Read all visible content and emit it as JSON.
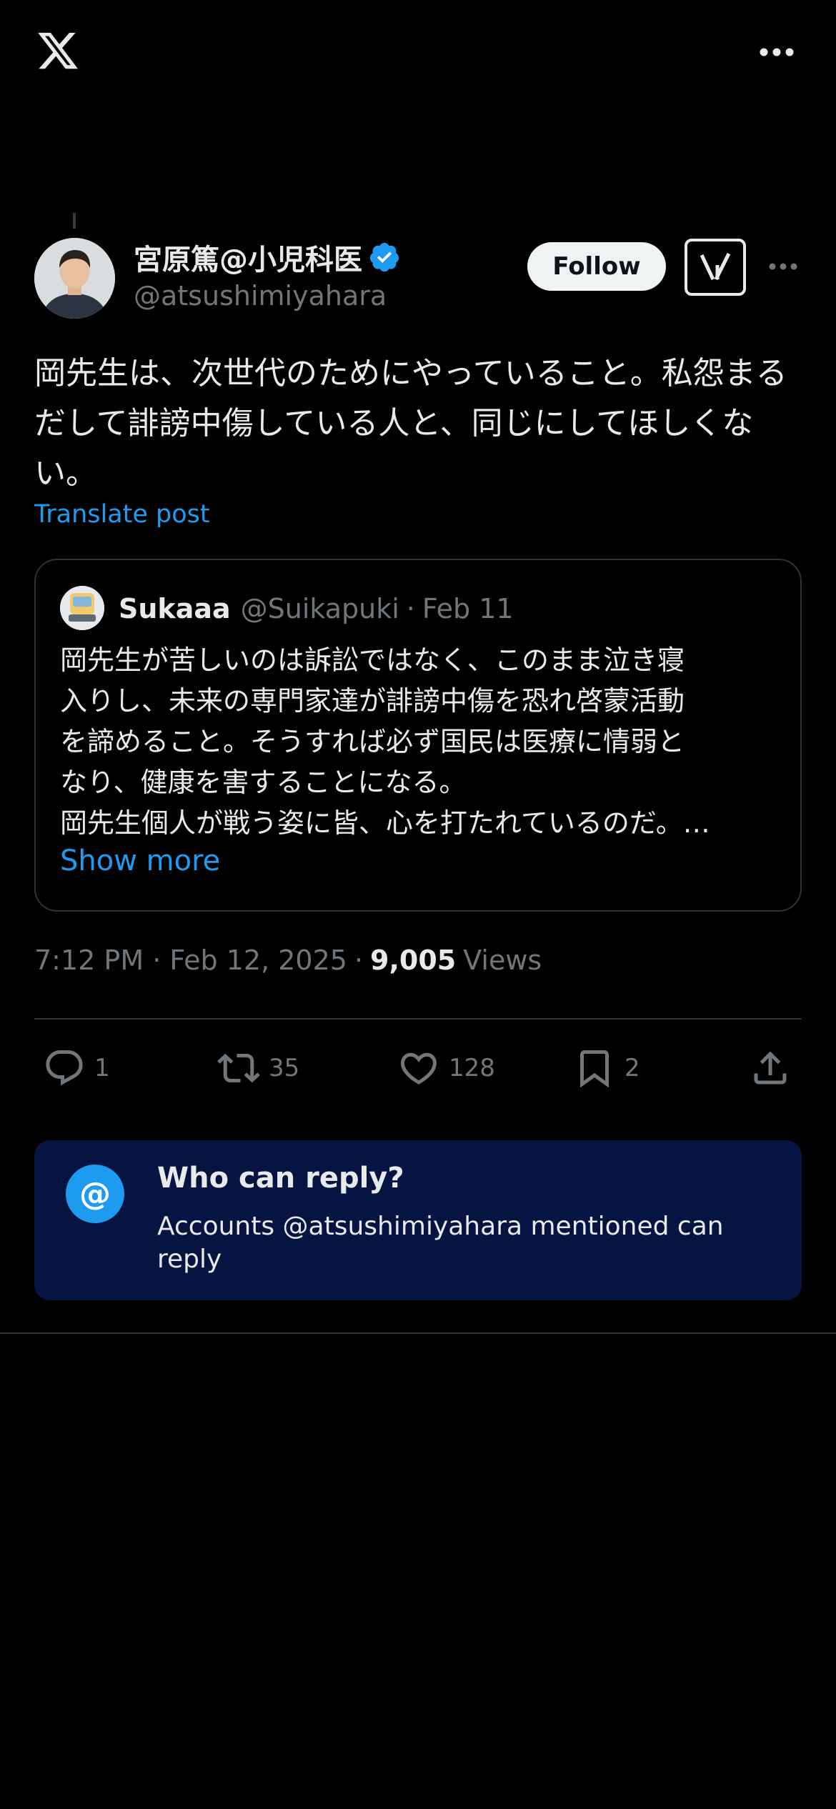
{
  "post": {
    "author": {
      "display_name": "宮原篤@小児科医",
      "handle": "@atsushimiyahara"
    },
    "follow_label": "Follow",
    "text": "岡先生は、次世代のためにやっていること。私怨まるだして誹謗中傷している人と、同じにしてほしくない。",
    "translate_label": "Translate post",
    "timestamp": "7:12 PM · Feb 12, 2025",
    "views_count": "9,005",
    "views_label": "Views"
  },
  "quote": {
    "name": "Sukaaa",
    "handle": "@Suikapuki",
    "dot": "·",
    "date": "Feb 11",
    "lines": [
      "岡先生が苦しいのは訴訟ではなく、このまま泣き寝",
      "入りし、未来の専門家達が誹謗中傷を恐れ啓蒙活動",
      "を諦めること。そうすれば必ず国民は医療に情弱と",
      "なり、健康を害することになる。",
      "岡先生個人が戦う姿に皆、心を打たれているのだ。…"
    ],
    "show_more_label": "Show more"
  },
  "actions": {
    "replies": "1",
    "reposts": "35",
    "likes": "128",
    "bookmarks": "2"
  },
  "who_can_reply": {
    "icon": "@",
    "title": "Who can reply?",
    "description": "Accounts @atsushimiyahara mentioned can reply"
  },
  "colors": {
    "accent": "#1d9bf0",
    "background": "#000000",
    "reply_card": "#051440",
    "muted": "#71767b"
  }
}
